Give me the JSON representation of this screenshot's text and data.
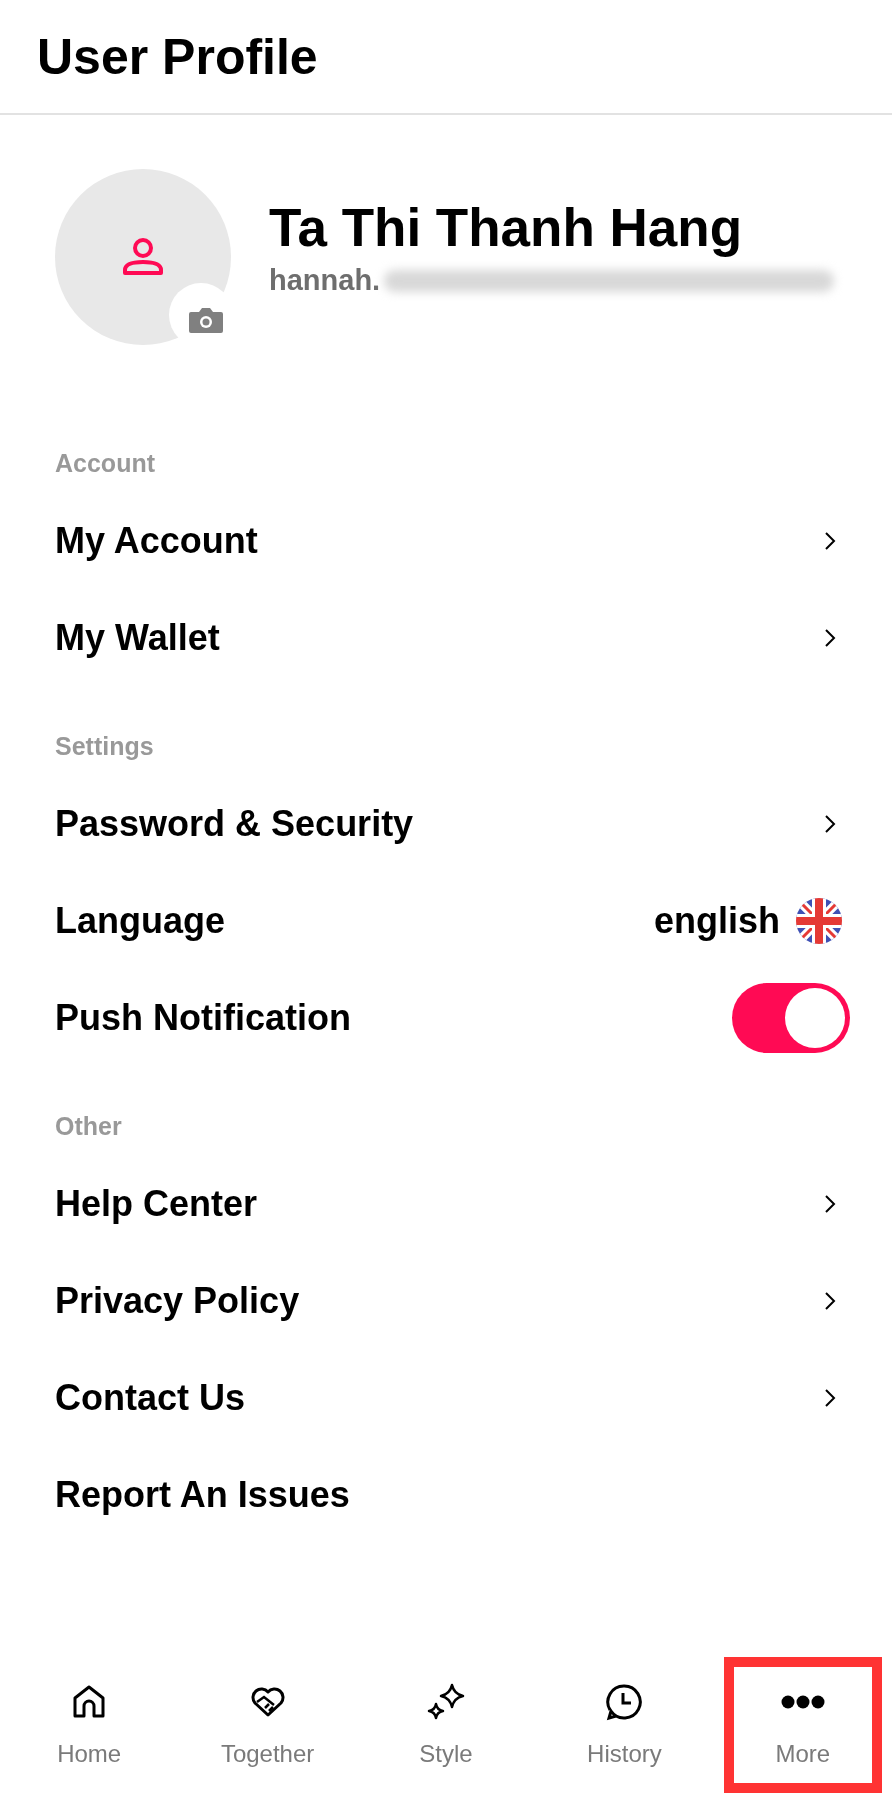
{
  "header": {
    "title": "User Profile"
  },
  "profile": {
    "name": "Ta Thi Thanh Hang",
    "email": "hannah.",
    "email_redacted": true
  },
  "sections": [
    {
      "title": "Account",
      "rows": [
        {
          "kind": "link",
          "label": "My Account"
        },
        {
          "kind": "link",
          "label": "My Wallet"
        }
      ]
    },
    {
      "title": "Settings",
      "rows": [
        {
          "kind": "link",
          "label": "Password & Security"
        },
        {
          "kind": "select",
          "label": "Language",
          "value": "english"
        },
        {
          "kind": "toggle",
          "label": "Push Notification",
          "on": true
        }
      ]
    },
    {
      "title": "Other",
      "rows": [
        {
          "kind": "link",
          "label": "Help Center"
        },
        {
          "kind": "link",
          "label": "Privacy Policy"
        },
        {
          "kind": "link",
          "label": "Contact Us"
        },
        {
          "kind": "plain",
          "label": "Report An Issues"
        }
      ]
    }
  ],
  "tab_bar": [
    {
      "kind": "home",
      "label": "Home",
      "highlighted": false
    },
    {
      "kind": "together",
      "label": "Together",
      "highlighted": false
    },
    {
      "kind": "style",
      "label": "Style",
      "highlighted": false
    },
    {
      "kind": "history",
      "label": "History",
      "highlighted": false
    },
    {
      "kind": "more",
      "label": "More",
      "highlighted": true
    }
  ]
}
